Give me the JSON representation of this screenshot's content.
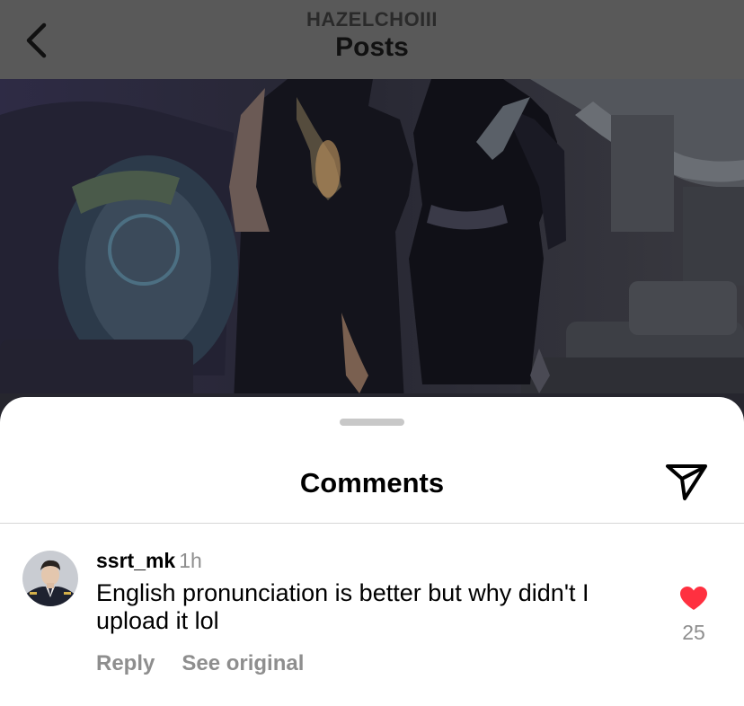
{
  "header": {
    "back_icon": "chevron-left-icon",
    "subtitle": "HAZELCHOIII",
    "title": "Posts"
  },
  "sheet": {
    "title": "Comments",
    "share_icon": "paper-plane-icon"
  },
  "comment": {
    "username": "ssrt_mk",
    "time": "1h",
    "text": "English pronunciation is better but why didn't I upload it lol",
    "reply_label": "Reply",
    "see_original_label": "See original",
    "like_icon": "heart-filled-icon",
    "like_count": "25",
    "liked": true
  },
  "colors": {
    "like_red": "#ff3040",
    "secondary_text": "#8e8e8e",
    "overlay_dim": "#595959"
  }
}
